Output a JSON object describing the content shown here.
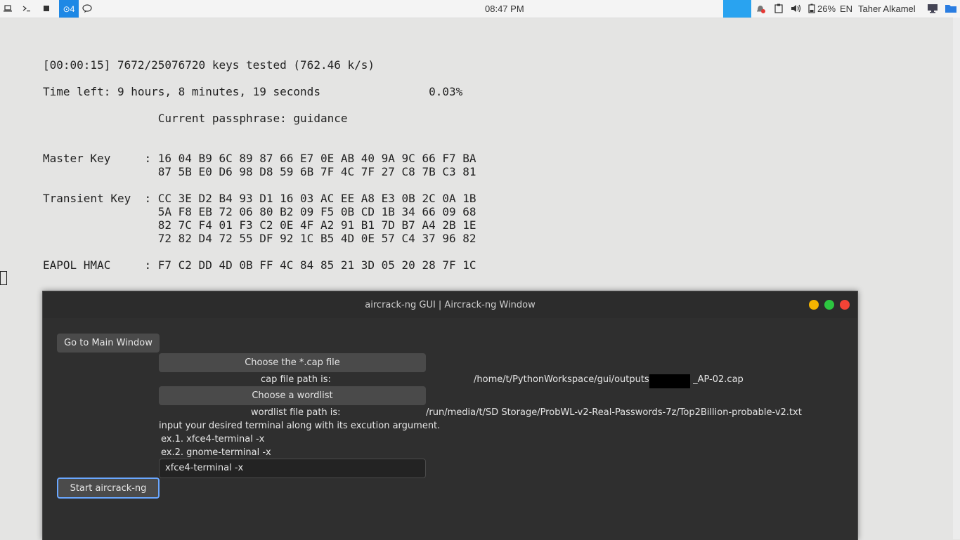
{
  "panel": {
    "workspace": "⊙4",
    "clock": "08:47 PM",
    "battery": "26%",
    "lang": "EN",
    "user": "Taher Alkamel"
  },
  "terminal": {
    "lines": [
      "[00:00:15] 7672/25076720 keys tested (762.46 k/s)",
      "",
      "Time left: 9 hours, 8 minutes, 19 seconds                0.03%",
      "",
      "                 Current passphrase: guidance",
      "",
      "",
      "Master Key     : 16 04 B9 6C 89 87 66 E7 0E AB 40 9A 9C 66 F7 BA",
      "                 87 5B E0 D6 98 D8 59 6B 7F 4C 7F 27 C8 7B C3 81",
      "",
      "Transient Key  : CC 3E D2 B4 93 D1 16 03 AC EE A8 E3 0B 2C 0A 1B",
      "                 5A F8 EB 72 06 80 B2 09 F5 0B CD 1B 34 66 09 68",
      "                 82 7C F4 01 F3 C2 0E 4F A2 91 B1 7D B7 A4 2B 1E",
      "                 72 82 D4 72 55 DF 92 1C B5 4D 0E 57 C4 37 96 82",
      "",
      "EAPOL HMAC     : F7 C2 DD 4D 0B FF 4C 84 85 21 3D 05 20 28 7F 1C"
    ]
  },
  "window": {
    "title": "aircrack-ng GUI | Aircrack-ng Window",
    "buttons": {
      "main": "Go to Main Window",
      "cap": "Choose the *.cap file",
      "wordlist": "Choose a wordlist",
      "start": "Start aircrack-ng"
    },
    "labels": {
      "cap_path_label": "cap file path is:",
      "cap_path_prefix": "/home/t/PythonWorkspace/gui/outputs/",
      "cap_path_suffix": "_AP-02.cap",
      "wordlist_path_label": "wordlist file path is:",
      "wordlist_path": "/run/media/t/SD Storage/ProbWL-v2-Real-Passwords-7z/Top2Billion-probable-v2.txt",
      "terminal_instruction": "input your desired terminal along with its excution argument.",
      "ex1": "ex.1. xfce4-terminal -x",
      "ex2": "ex.2. gnome-terminal -x"
    },
    "terminal_input_value": "xfce4-terminal -x",
    "colors": {
      "close": "#f44336",
      "max": "#2cc640",
      "min": "#f4b400",
      "focus": "#6aa7ff"
    }
  }
}
